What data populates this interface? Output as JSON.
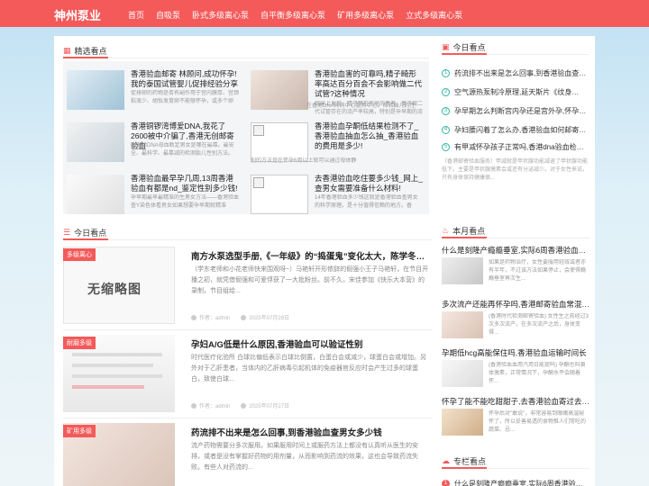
{
  "site": {
    "logo": "神州泵业"
  },
  "nav": [
    "首页",
    "自吸泵",
    "卧式多级离心泵",
    "自平衡多级离心泵",
    "矿用多级离心泵",
    "立式多级离心泵"
  ],
  "featured": {
    "title": "精选看点",
    "items": [
      {
        "title": "香港验血邮寄 林顾问,成功怀孕!我的泰国试管婴儿促排经验分享",
        "desc": "促排卵的药物是否有副作用于宫内膜厚、宫颈粘液少、胡怡发育卵不能够怀孕，或多个卵"
      },
      {
        "title": "香港验血害的可靠吗,精子畸形率高达百分百会不会影响做二代试管?这种情况",
        "desc": "临床上发现，精子畸形率高的患者，妻子做二代试管存在的流产率较高，特别是孕早期的流"
      },
      {
        "title": "香港铜锣湾博爱DNA,我花了2600被中介骗了,香港无创邮寄验血",
        "desc": "香港验DNA母血断定男女是哪在最靠。最安全、最科学、最靠减的检测胎儿性别方法。"
      },
      {
        "title": "香港验血孕酮低结果检测不了_香港验血抽血怎么抽_香港验血的费用是多少!",
        "desc": "别的方法是在怀孕6周以上就可以通过母体静"
      },
      {
        "title": "香港验血最早孕几周,13周香港验血有都是nd_鉴定性别多少钱!",
        "desc": "孕早期最早最精准的生男女方法——香港验血查Y染色体看男女如果想要孕早期就精准"
      },
      {
        "title": "去香港验血吃住要多少钱_网上_查男女需要准备什么材料!",
        "desc": "14年香港验血多少钱这就是香港验血查男女的科学原理。是十分值得信赖的地方。香"
      }
    ],
    "fragment": "在香港DNA抑的中心服务中心。检验胎儿的性"
  },
  "today_left": {
    "title": "今日看点",
    "no_thumb": "无缩略图",
    "articles": [
      {
        "tag": "多级离心",
        "title": "南方水泵选型手册,《一年级》的“捣蛋鬼”变化太大，陈学冬宋…",
        "desc": "（学东老师和小花老师快来围观呀~）马艳轩开形侬辞的倔强小王子马艳轩，在节目开播之初，就凭借倔强和可爱俘获了一大批粉丝。前不久，宋佳参加《快乐大本营》的录制，节目组给...",
        "author": "作者：admin",
        "date": "2025年07月28日"
      },
      {
        "tag": "耐磨多级",
        "title": "孕妇A/G低是什么原因,香港验血可以验证性别",
        "desc": "时代医疗化验所 白球比偏低表示白球比倒置，白蛋白会或减少，球蛋白会或增加。另外对于乙肝患者，当体内的乙肝病毒引起机体的免疫器官反应时会产生过多的球蛋白，致使白球...",
        "author": "作者：admin",
        "date": "2025年07月27日"
      },
      {
        "tag": "矿用多级",
        "title": "药流排不出来是怎么回事,到香港验血查男女多少钱",
        "desc": "流产药物需要分多次服用。如果服用时间上或服药方法上都没有认真听从医生的安排，或者是没有掌握好药物的用剂量，从而影响到药流的效果，这也会导致药流失败。有些人对药流的...",
        "author": "",
        "date": ""
      }
    ]
  },
  "today_right": {
    "title": "今日看点",
    "items": [
      {
        "num": "1",
        "text": "药流排不出来是怎么回事,到香港验血查…"
      },
      {
        "num": "2",
        "text": "空气源热泵制冷原理,延天斯片《纹身…"
      },
      {
        "num": "3",
        "text": "孕早期怎么判断宫内孕还是宫外孕,怀孕…"
      },
      {
        "num": "4",
        "text": "孕妇腰闪着了怎么办,香港验血如何邮寄…"
      },
      {
        "num": "5",
        "text": "有甲减怀孕孩子正常吗,香港dna验血检…"
      }
    ],
    "note": "（香港邮寄验血服务）甲减就是甲状腺功能减退了甲状腺功能低下。主要是甲状腺激素会或还有分泌减少。对于女性来说，只有身体保持健康很..."
  },
  "month": {
    "title": "本月看点",
    "items": [
      {
        "title": "什么是刻隆产瘾瘾垂室,实际6周香港验血写…",
        "desc": "如果是药物治疗，女性要服用轻效或者亦有半年，不过该方法如果停止，会使得瘾瘾垂室再次生..."
      },
      {
        "title": "多次流产还能再怀孕吗,香港邮寄验血常混…",
        "desc": "(香港时代检测邮寄验血) 女性生之前经过3次多次流产，在多次流产之后，身体变得..."
      },
      {
        "title": "孕期低hcg高能保住吗,香港验血运输时间长",
        "desc": "(香港验血血用汽用日能提吗) 孕酮也叫黄体激素，正常情况下，孕酮水平会随着怀..."
      },
      {
        "title": "怀孕了能不能吃甜甜子,去香港验血寄过去…",
        "desc": "怀孕后对\"敢说\"，非常容易到眼嫩高温秘怀了，所以妥善易透的食物惟人们常吃的蔬菜、忌..."
      }
    ]
  },
  "column": {
    "title": "专栏看点",
    "first": "什么是刻隆产瘾瘾垂室,实际6周香港验血写…"
  }
}
